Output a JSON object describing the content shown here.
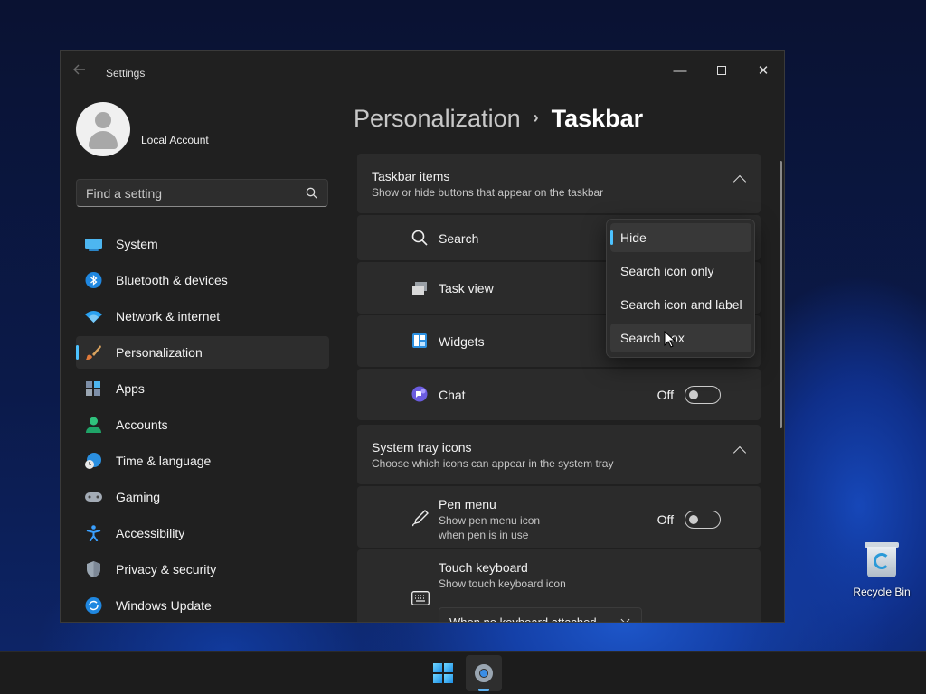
{
  "desktop": {
    "recycle_bin_label": "Recycle Bin"
  },
  "taskbar": {
    "start_icon": "windows-logo-icon",
    "settings_icon": "gear-icon"
  },
  "window": {
    "title": "Settings",
    "back_icon": "back-arrow-icon",
    "controls": {
      "minimize": "—",
      "close": "✕"
    }
  },
  "account": {
    "name": "Local Account"
  },
  "search": {
    "placeholder": "Find a setting",
    "value": ""
  },
  "sidebar": {
    "items": [
      {
        "label": "System",
        "icon": "system-monitor-icon",
        "active": false
      },
      {
        "label": "Bluetooth & devices",
        "icon": "bluetooth-icon",
        "active": false
      },
      {
        "label": "Network & internet",
        "icon": "wifi-icon",
        "active": false
      },
      {
        "label": "Personalization",
        "icon": "paintbrush-icon",
        "active": true
      },
      {
        "label": "Apps",
        "icon": "apps-icon",
        "active": false
      },
      {
        "label": "Accounts",
        "icon": "person-icon",
        "active": false
      },
      {
        "label": "Time & language",
        "icon": "globe-clock-icon",
        "active": false
      },
      {
        "label": "Gaming",
        "icon": "gamepad-icon",
        "active": false
      },
      {
        "label": "Accessibility",
        "icon": "accessibility-icon",
        "active": false
      },
      {
        "label": "Privacy & security",
        "icon": "shield-icon",
        "active": false
      },
      {
        "label": "Windows Update",
        "icon": "update-icon",
        "active": false
      }
    ]
  },
  "breadcrumb": {
    "parent": "Personalization",
    "separator": "›",
    "current": "Taskbar"
  },
  "taskbar_items": {
    "title": "Taskbar items",
    "description": "Show or hide buttons that appear on the taskbar",
    "rows": {
      "search": {
        "label": "Search"
      },
      "task_view": {
        "label": "Task view"
      },
      "widgets": {
        "label": "Widgets"
      },
      "chat": {
        "label": "Chat",
        "state": "Off"
      }
    }
  },
  "search_dropdown": {
    "options": [
      "Hide",
      "Search icon only",
      "Search icon and label",
      "Search box"
    ],
    "selected": "Hide",
    "hovered": "Search box"
  },
  "system_tray": {
    "title": "System tray icons",
    "description": "Choose which icons can appear in the system tray",
    "pen_menu": {
      "label": "Pen menu",
      "description_line1": "Show pen menu icon",
      "description_line2": "when pen is in use",
      "state": "Off"
    },
    "touch_keyboard": {
      "label": "Touch keyboard",
      "description": "Show touch keyboard icon",
      "select_value": "When no keyboard attached"
    }
  },
  "colors": {
    "accent": "#4cc2ff",
    "window_bg": "#202020",
    "card_bg": "#2b2b2b"
  }
}
